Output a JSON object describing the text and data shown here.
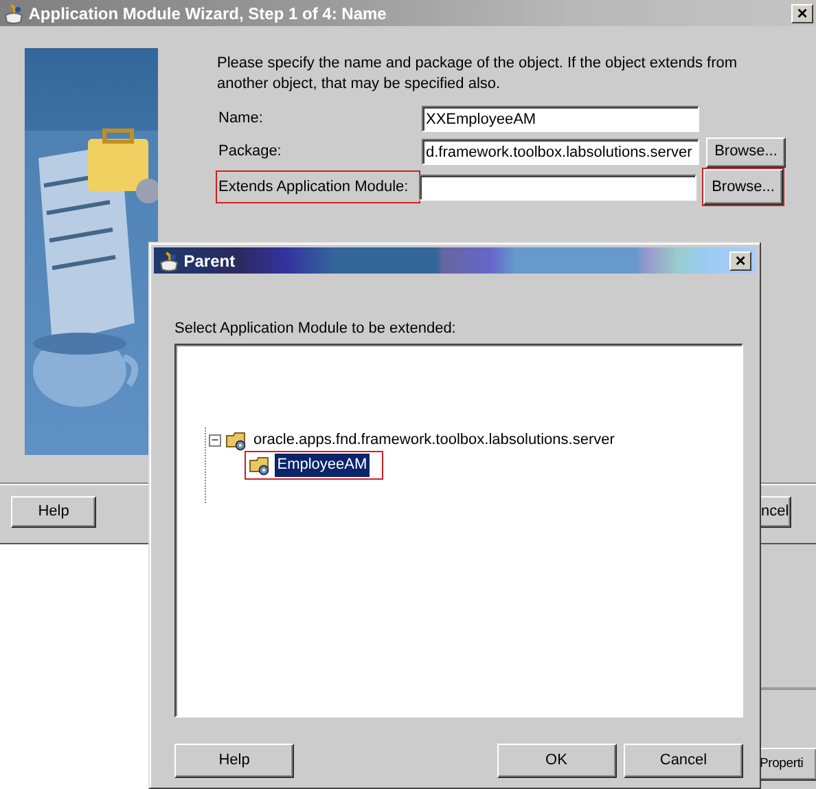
{
  "window": {
    "title": "Application Module Wizard, Step 1 of 4: Name",
    "close": "×"
  },
  "intro": "Please specify the name and package of the object.  If the object extends from another object, that may be specified also.",
  "fields": [
    {
      "label": "Name:",
      "value": "XXEmployeeAM",
      "highlighted": false
    },
    {
      "label": "Package:",
      "value": "d.framework.toolbox.labsolutions.server",
      "browse": "Browse...",
      "highlighted": false
    },
    {
      "label": "Extends Application Module:",
      "browse": "Browse...",
      "highlighted": true
    }
  ],
  "wizard_buttons": {
    "help": "Help",
    "cancel": "ncel",
    "properties": "Properti"
  },
  "dialog": {
    "title": "Parent",
    "close": "×",
    "prompt": "Select Application Module to be extended:",
    "tree": [
      {
        "label": "oracle.apps.fnd.framework.toolbox.labsolutions.server",
        "expanded": true,
        "selected": false,
        "highlighted": false,
        "expander": "−",
        "children": [
          {
            "label": "EmployeeAM",
            "selected": true,
            "highlighted": true
          }
        ]
      }
    ],
    "buttons": [
      {
        "label": "Help",
        "kind": "left"
      },
      {
        "label": "OK",
        "kind": "right"
      },
      {
        "label": "Cancel",
        "kind": "right"
      }
    ]
  }
}
